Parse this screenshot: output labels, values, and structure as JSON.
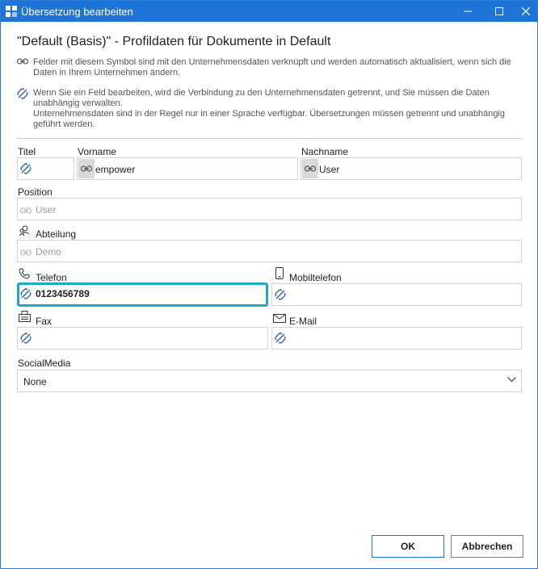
{
  "window": {
    "title": "Übersetzung bearbeiten"
  },
  "dialog": {
    "heading": "\"Default (Basis)\" - Profildaten für Dokumente in Default",
    "note_linked": "Felder mit diesem Symbol sind mit den Unternehmensdaten verknüpft und werden automatisch aktualisiert, wenn sich die Daten in Ihrem Unternehmen ändern.",
    "note_unlinked": "Wenn Sie ein Feld bearbeiten, wird die Verbindung zu den Unternehmensdaten getrennt, und Sie müssen die Daten unabhängig verwalten.",
    "note_language": "Unternehmensdaten sind in der Regel nur in einer Sprache verfügbar. Übersetzungen müssen getrennt und unabhängig geführt werden."
  },
  "fields": {
    "titel": {
      "label": "Titel",
      "value": ""
    },
    "vorname": {
      "label": "Vorname",
      "value": "empower"
    },
    "nachname": {
      "label": "Nachname",
      "value": "User"
    },
    "position": {
      "label": "Position",
      "value": "User"
    },
    "abteilung": {
      "label": "Abteilung",
      "value": "Demo"
    },
    "telefon": {
      "label": "Telefon",
      "value": "0123456789"
    },
    "mobiltelefon": {
      "label": "Mobiltelefon",
      "value": ""
    },
    "fax": {
      "label": "Fax",
      "value": ""
    },
    "email": {
      "label": "E-Mail",
      "value": ""
    },
    "socialmedia": {
      "label": "SocialMedia",
      "value": "None"
    }
  },
  "buttons": {
    "ok": "OK",
    "cancel": "Abbrechen"
  },
  "colors": {
    "titlebar": "#1f74d8",
    "focus": "#1ea9cc",
    "unlink_icon": "#2b5fa8"
  }
}
